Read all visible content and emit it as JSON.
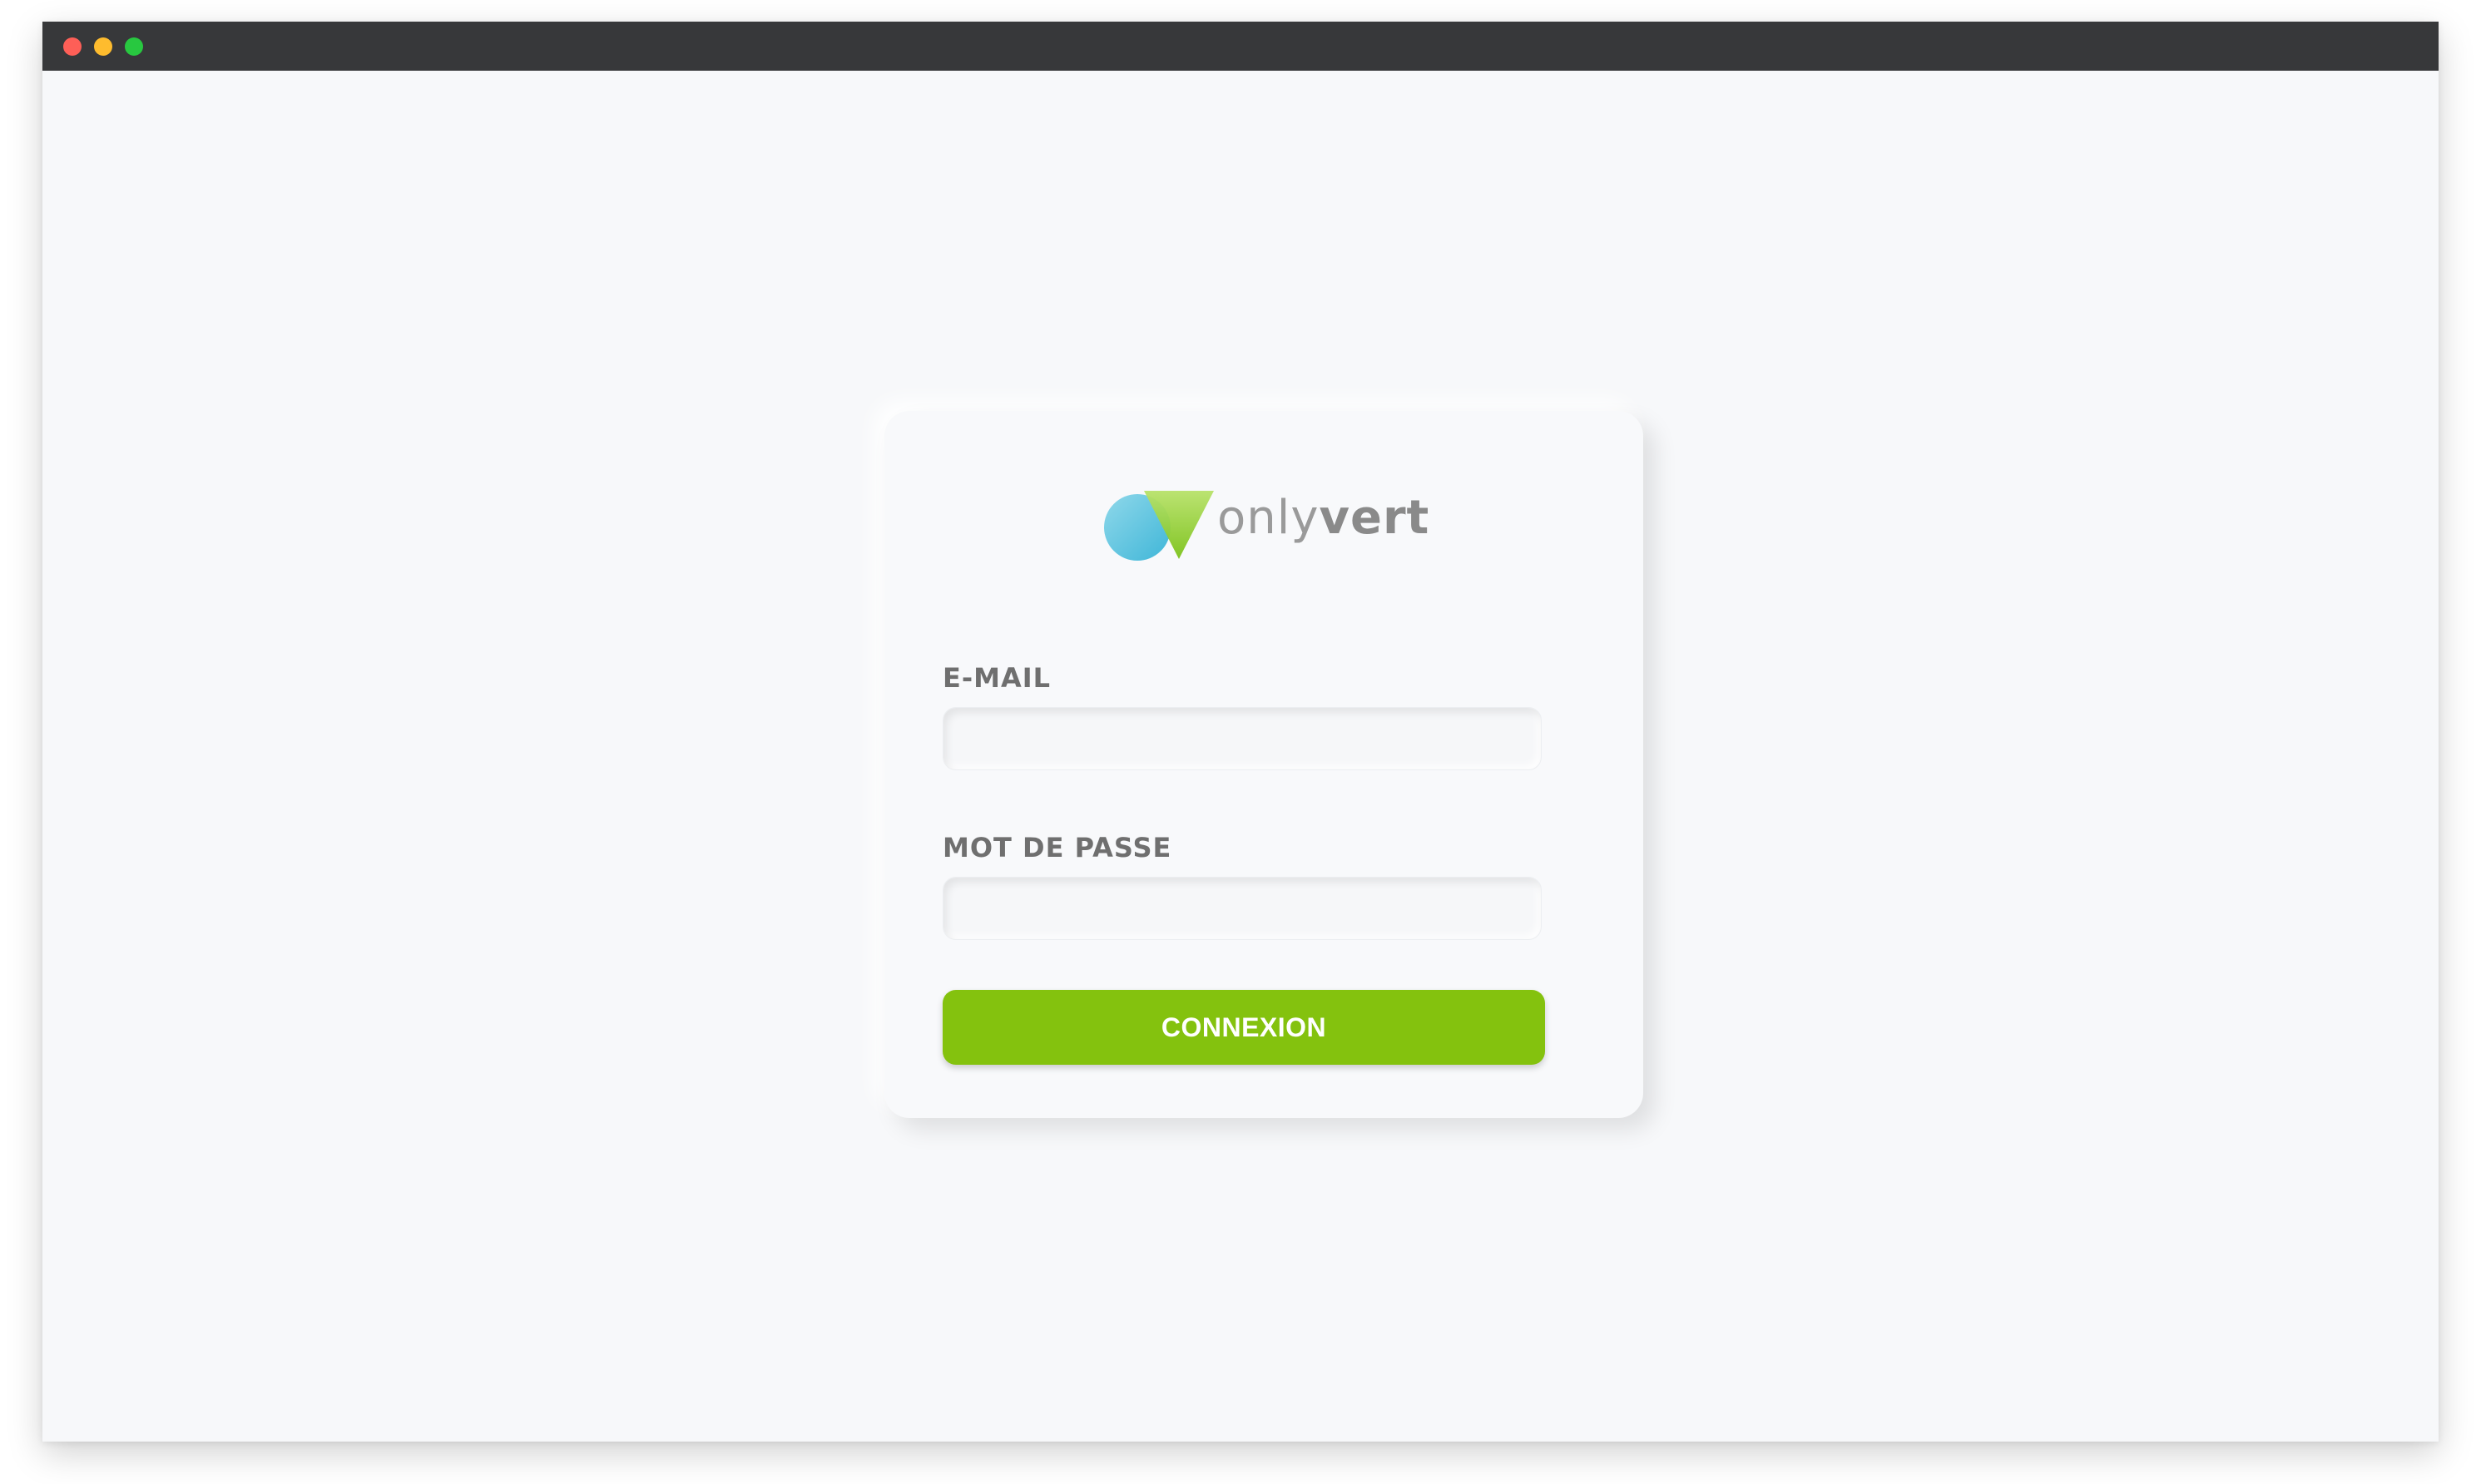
{
  "window": {
    "controls": [
      "close",
      "minimize",
      "maximize"
    ]
  },
  "brand": {
    "name_light": "only",
    "name_bold": "vert",
    "icon": "onlyvert-logo-icon"
  },
  "login": {
    "email_label": "E-MAIL",
    "email_value": "",
    "email_placeholder": "",
    "password_label": "MOT DE PASSE",
    "password_value": "",
    "password_placeholder": "",
    "submit_label": "CONNEXION"
  },
  "colors": {
    "accent": "#84c20e",
    "titlebar": "#37383a",
    "background": "#f7f8fa"
  }
}
